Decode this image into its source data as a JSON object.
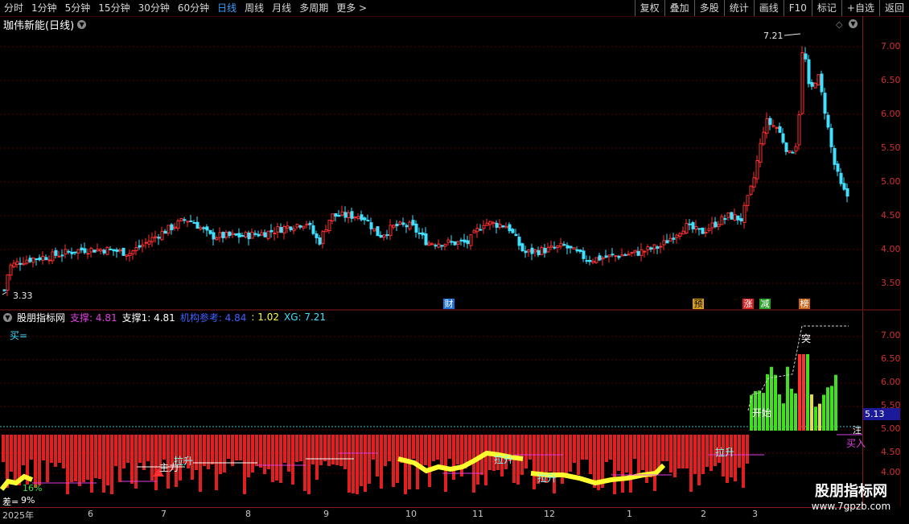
{
  "toolbar": {
    "periods": [
      "分时",
      "1分钟",
      "5分钟",
      "15分钟",
      "30分钟",
      "60分钟",
      "日线",
      "周线",
      "月线",
      "多周期",
      "更多 >"
    ],
    "active": "日线",
    "right_buttons": [
      "复权",
      "叠加",
      "多股",
      "统计",
      "画线",
      "F10",
      "标记",
      "+自选",
      "返回"
    ]
  },
  "title": "珈伟新能(日线)",
  "main_chart": {
    "y_ticks": [
      "7.00",
      "6.50",
      "6.00",
      "5.50",
      "5.00",
      "4.50",
      "4.00",
      "3.50"
    ],
    "high_label": "7.21",
    "low_label": "3.33",
    "event_markers": [
      {
        "text": "财",
        "color": "#1e6fd8"
      },
      {
        "text": "预",
        "color": "#d8a018"
      },
      {
        "text": "涨",
        "color": "#d82020"
      },
      {
        "text": "减",
        "color": "#2aa02a"
      },
      {
        "text": "榜",
        "color": "#c86418"
      }
    ]
  },
  "indicator": {
    "name": "股朋指标网",
    "params": [
      {
        "text": "支撑: 4.81",
        "color": "#e040e0"
      },
      {
        "text": "支撑1: 4.81",
        "color": "#ffffff"
      },
      {
        "text": "机构参考: 4.84",
        "color": "#4060ff"
      },
      {
        "text": ": 1.02",
        "color": "#ffff40"
      },
      {
        "text": "XG: 7.21",
        "color": "#40e0ff"
      }
    ],
    "buy_eq": "买=",
    "y_ticks": [
      "7.00",
      "6.50",
      "6.00",
      "5.50",
      "5.00",
      "4.50",
      "4.00"
    ],
    "price_box": "5.13",
    "labels": {
      "zhuli": "主力",
      "lasheng1": "拉升",
      "lasheng2": "拉升",
      "lasheng3": "拉升",
      "lasheng4": "拉升",
      "kaishi": "开始",
      "tu": "突",
      "mai": "买入",
      "zhu": "注",
      "pct1": "16%",
      "pct2": "9%",
      "cha": "差="
    }
  },
  "xaxis": {
    "labels": [
      "2025年",
      "6",
      "7",
      "8",
      "9",
      "10",
      "11",
      "12",
      "1",
      "2",
      "3"
    ]
  },
  "watermark": {
    "line1": "股朋指标网",
    "line2": "www.7gpzb.com"
  }
}
